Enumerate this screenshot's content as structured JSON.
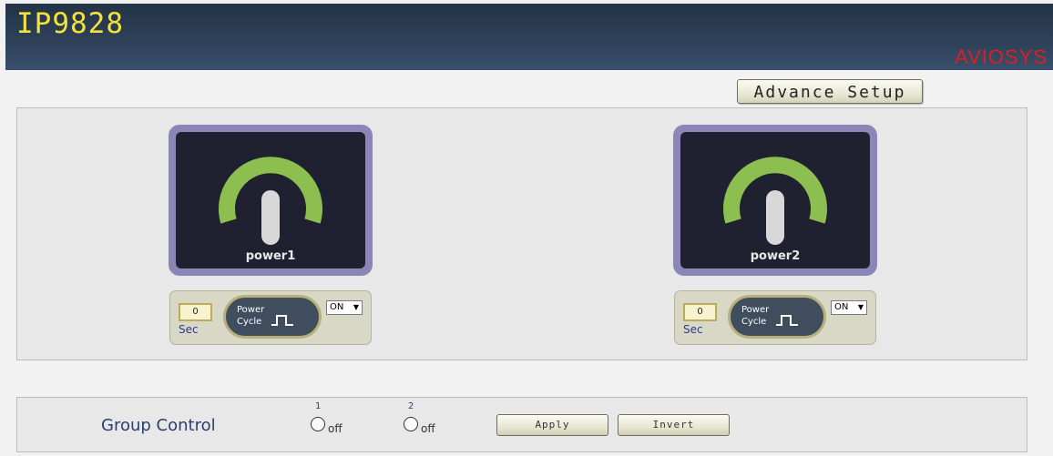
{
  "header": {
    "title": "IP9828",
    "brand": "AVIOSYS"
  },
  "advance_setup": {
    "label": "Advance Setup"
  },
  "outlets": [
    {
      "name": "power1",
      "delay": "0",
      "sec_label": "Sec",
      "power_cycle": [
        "Power",
        "Cycle"
      ],
      "mode": "ON",
      "state": "on"
    },
    {
      "name": "power2",
      "delay": "0",
      "sec_label": "Sec",
      "power_cycle": [
        "Power",
        "Cycle"
      ],
      "mode": "ON",
      "state": "on"
    }
  ],
  "group_control": {
    "label": "Group Control",
    "radios": [
      {
        "number": "1",
        "text": "off"
      },
      {
        "number": "2",
        "text": "off"
      }
    ],
    "apply_label": "Apply",
    "invert_label": "Invert"
  },
  "colors": {
    "header_title": "#f3e23a",
    "brand": "#d42222",
    "power_arc": "#8cbf4f",
    "outlet_frame": "#8c85b7"
  }
}
